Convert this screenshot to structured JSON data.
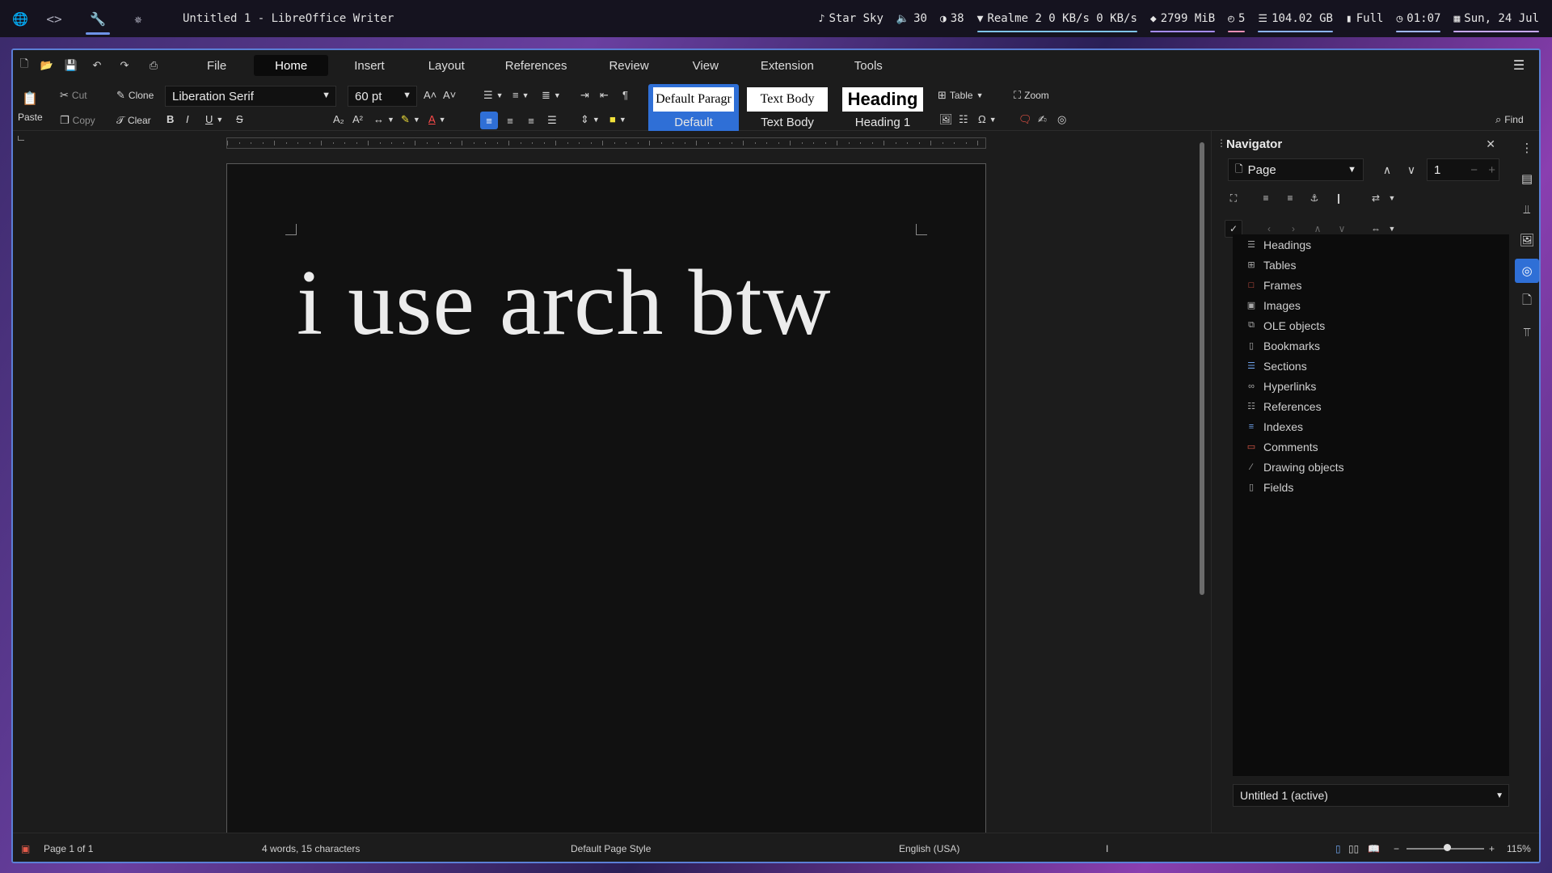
{
  "topbar": {
    "icons": [
      "globe-icon",
      "code-icon",
      "wrench-icon",
      "pinwheel-icon"
    ],
    "window_title": "Untitled 1 - LibreOffice Writer",
    "stats": {
      "music": "Star Sky",
      "volume": "30",
      "brightness": "38",
      "network": "Realme 2 0 KB/s 0 KB/s",
      "memory": "2799 MiB",
      "updates": "5",
      "disk": "104.02 GB",
      "battery": "Full",
      "time": "01:07",
      "date": "Sun, 24 Jul"
    },
    "colors": {
      "music": "#e4e4e4",
      "volume": "#e4e4e4",
      "brightness": "#e4e4e4",
      "network": "#7fc4e8",
      "memory": "#a68cff",
      "updates": "#e88fb4",
      "disk": "#8cb4ff",
      "battery": "#c8c8c8",
      "time": "#9fb8ff",
      "date": "#c6a8ff"
    }
  },
  "menu": {
    "tabs": [
      "File",
      "Home",
      "Insert",
      "Layout",
      "References",
      "Review",
      "View",
      "Extension",
      "Tools"
    ],
    "active": "Home"
  },
  "ribbon": {
    "paste": "Paste",
    "cut": "Cut",
    "copy": "Copy",
    "clone": "Clone",
    "clear": "Clear",
    "font_name": "Liberation Serif",
    "font_size": "60 pt",
    "styles": [
      {
        "preview": "Default Paragr",
        "label": "Default"
      },
      {
        "preview": "Text Body",
        "label": "Text Body"
      },
      {
        "preview": "Heading",
        "label": "Heading 1"
      }
    ],
    "table": "Table",
    "zoom": "Zoom",
    "find": "Find"
  },
  "document": {
    "text": "i use arch btw"
  },
  "navigator": {
    "title": "Navigator",
    "category": "Page",
    "page_number": "1",
    "items": [
      {
        "label": "Headings",
        "icon": "headings-icon"
      },
      {
        "label": "Tables",
        "icon": "table-icon"
      },
      {
        "label": "Frames",
        "icon": "frame-icon"
      },
      {
        "label": "Images",
        "icon": "image-icon"
      },
      {
        "label": "OLE objects",
        "icon": "ole-icon"
      },
      {
        "label": "Bookmarks",
        "icon": "bookmark-icon"
      },
      {
        "label": "Sections",
        "icon": "section-icon"
      },
      {
        "label": "Hyperlinks",
        "icon": "hyperlink-icon"
      },
      {
        "label": "References",
        "icon": "reference-icon"
      },
      {
        "label": "Indexes",
        "icon": "index-icon"
      },
      {
        "label": "Comments",
        "icon": "comment-icon"
      },
      {
        "label": "Drawing objects",
        "icon": "drawing-icon"
      },
      {
        "label": "Fields",
        "icon": "field-icon"
      }
    ],
    "document": "Untitled 1 (active)"
  },
  "statusbar": {
    "page": "Page 1 of 1",
    "words": "4 words, 15 characters",
    "page_style": "Default Page Style",
    "language": "English (USA)",
    "zoom": "115%"
  }
}
